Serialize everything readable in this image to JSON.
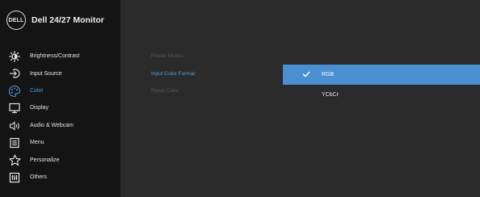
{
  "brand": {
    "logo_text": "DELL",
    "title": "Dell 24/27 Monitor"
  },
  "menu": [
    {
      "label": "Brightness/Contrast",
      "icon": "sun-icon"
    },
    {
      "label": "Input Source",
      "icon": "input-source-icon"
    },
    {
      "label": "Color",
      "icon": "palette-icon",
      "active": true
    },
    {
      "label": "Display",
      "icon": "display-icon"
    },
    {
      "label": "Audio & Webcam",
      "icon": "speaker-icon"
    },
    {
      "label": "Menu",
      "icon": "menu-icon"
    },
    {
      "label": "Personalize",
      "icon": "star-icon"
    },
    {
      "label": "Others",
      "icon": "others-icon"
    }
  ],
  "submenu": [
    {
      "label": "Preset Modes"
    },
    {
      "label": "Input Color Format",
      "selected": true
    },
    {
      "label": "Reset Color"
    }
  ],
  "options": [
    {
      "label": "RGB",
      "checked": true
    },
    {
      "label": "YCbCr",
      "checked": false
    }
  ],
  "colors": {
    "accent": "#4a8fd0",
    "sidebar": "#141414",
    "panel": "#2b2b2b"
  }
}
